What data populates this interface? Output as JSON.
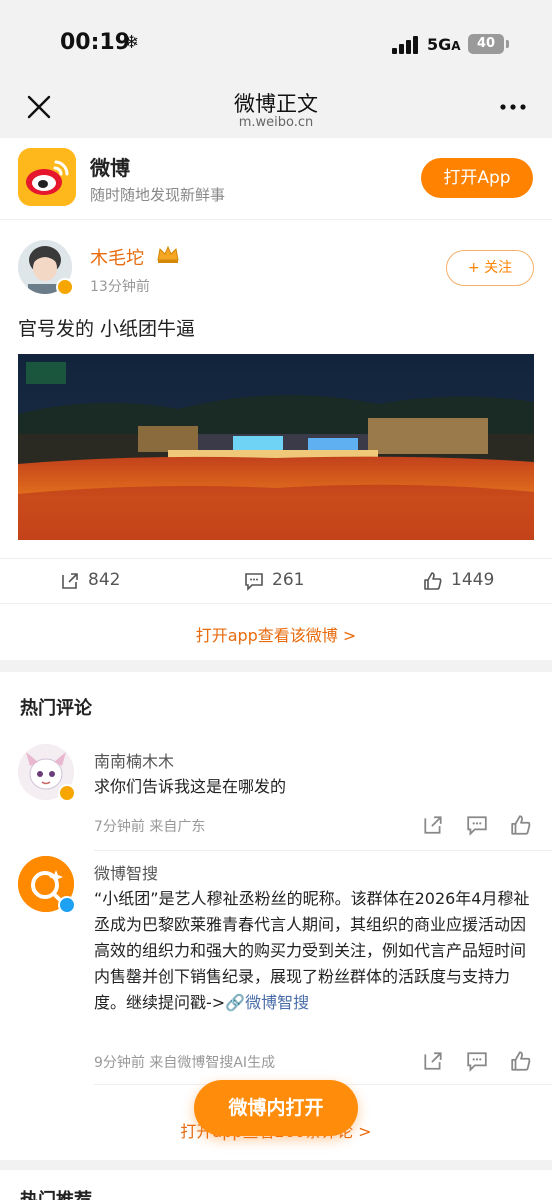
{
  "status_bar": {
    "time": "00:19",
    "network": "5G",
    "network_suffix": "A",
    "battery": "40"
  },
  "nav": {
    "title": "微博正文",
    "subtitle": "m.weibo.cn"
  },
  "app_banner": {
    "name": "微博",
    "tagline": "随时随地发现新鲜事",
    "open_button": "打开App"
  },
  "post": {
    "author": "木毛坨",
    "time": "13分钟前",
    "follow_button": "+ 关注",
    "text": "官号发的 小纸团牛逼",
    "reposts": "842",
    "comments": "261",
    "likes": "1449",
    "open_in_app_link": "打开app查看该微博 >"
  },
  "comments_section": {
    "title": "热门评论",
    "items": [
      {
        "name": "南南楠木木",
        "text": "求你们告诉我这是在哪发的",
        "meta": "7分钟前 来自广东"
      },
      {
        "name": "微博智搜",
        "text": "“小纸团”是艺人穆祉丞粉丝的昵称。该群体在2026年4月穆祉丞成为巴黎欧莱雅青春代言人期间，其组织的商业应援活动因高效的组织力和强大的购买力受到关注，例如代言产品短时间内售罄并创下销售纪录，展现了粉丝群体的活跃度与支持力度。继续提问戳->",
        "link": "🔗微博智搜",
        "meta": "9分钟前 来自微博智搜AI生成"
      }
    ],
    "more_link": "打开app查看260条评论 >"
  },
  "hot_recommend_title": "热门推荐",
  "floating_button": "微博内打开",
  "colors": {
    "accent": "#ff8200",
    "link": "#4a6ea9",
    "name_orange": "#e86b0e"
  }
}
